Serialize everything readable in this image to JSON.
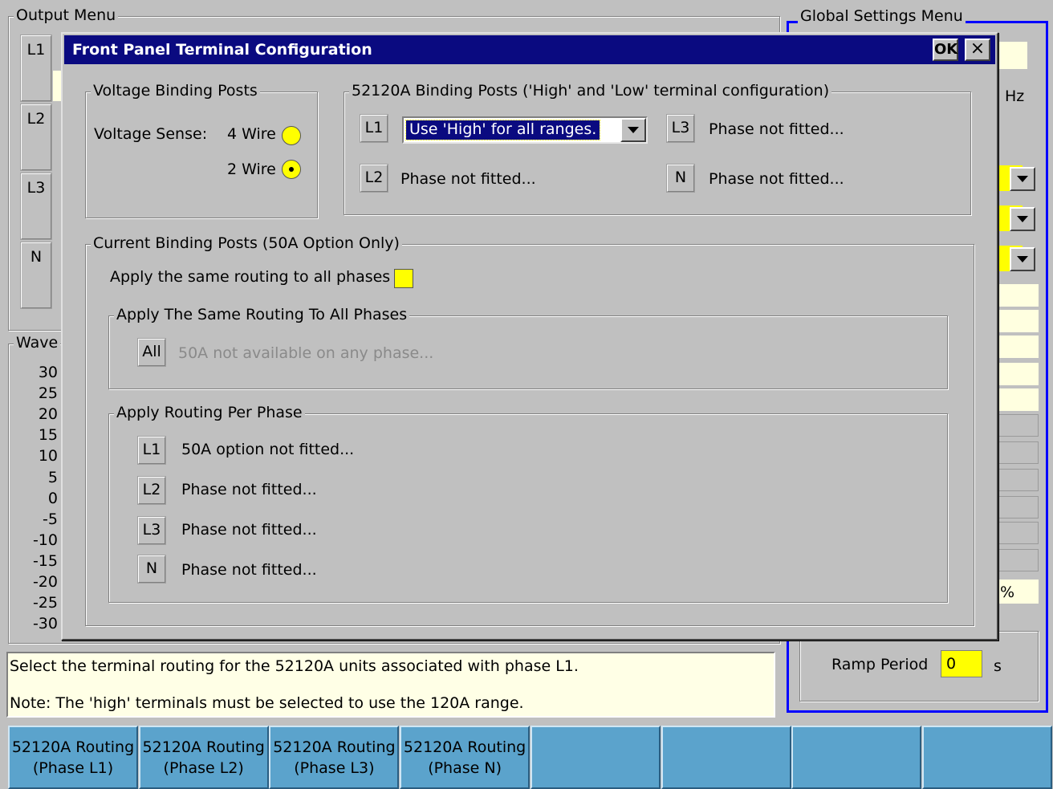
{
  "background": {
    "output_menu_title": "Output Menu",
    "phases": [
      "L1",
      "L2",
      "L3",
      "N"
    ],
    "waveform_title": "Wave",
    "waveform_ticks": [
      "30",
      "25",
      "20",
      "15",
      "10",
      "5",
      "0",
      "-5",
      "-10",
      "-15",
      "-20",
      "-25",
      "-30"
    ],
    "global_settings_title": "Global Settings Menu",
    "hz_unit": "Hz",
    "percent_unit": "%",
    "ramp_period_label": "Ramp Period",
    "ramp_period_value": "0",
    "ramp_period_unit": "s"
  },
  "dialog": {
    "title": "Front Panel Terminal Configuration",
    "ok_label": "OK",
    "close_label": "×",
    "voltage_group": {
      "title": "Voltage Binding Posts",
      "sense_label": "Voltage Sense:",
      "option_4wire": "4 Wire",
      "option_2wire": "2 Wire",
      "selected": "2 Wire"
    },
    "binding_group": {
      "title": "52120A Binding Posts ('High' and 'Low' terminal configuration)",
      "l1_tag": "L1",
      "l1_value": "Use 'High' for all ranges.",
      "l2_tag": "L2",
      "l2_text": "Phase not fitted...",
      "l3_tag": "L3",
      "l3_text": "Phase not fitted...",
      "n_tag": "N",
      "n_text": "Phase not fitted..."
    },
    "current_group": {
      "title": "Current Binding Posts (50A Option Only)",
      "same_routing_label": "Apply the same routing to all phases",
      "same_group_title": "Apply The Same Routing To All Phases",
      "all_tag": "All",
      "all_text": "50A not available on any phase...",
      "per_phase_title": "Apply Routing Per Phase",
      "rows": [
        {
          "tag": "L1",
          "text": "50A option not fitted..."
        },
        {
          "tag": "L2",
          "text": "Phase not fitted..."
        },
        {
          "tag": "L3",
          "text": "Phase not fitted..."
        },
        {
          "tag": "N",
          "text": "Phase not fitted..."
        }
      ]
    }
  },
  "status": {
    "line1": "Select the terminal routing for the 52120A units associated with phase L1.",
    "line2": "Note: The 'high' terminals must be selected to use the 120A range."
  },
  "softkeys": [
    "52120A Routing\n(Phase L1)",
    "52120A Routing\n(Phase L2)",
    "52120A Routing\n(Phase L3)",
    "52120A Routing\n(Phase N)",
    "",
    "",
    "",
    ""
  ],
  "colors": {
    "title_bar": "#0a0a80",
    "field_yellow": "#ffff00",
    "softkey_blue": "#5ba3cc",
    "global_border": "#0000ff"
  }
}
